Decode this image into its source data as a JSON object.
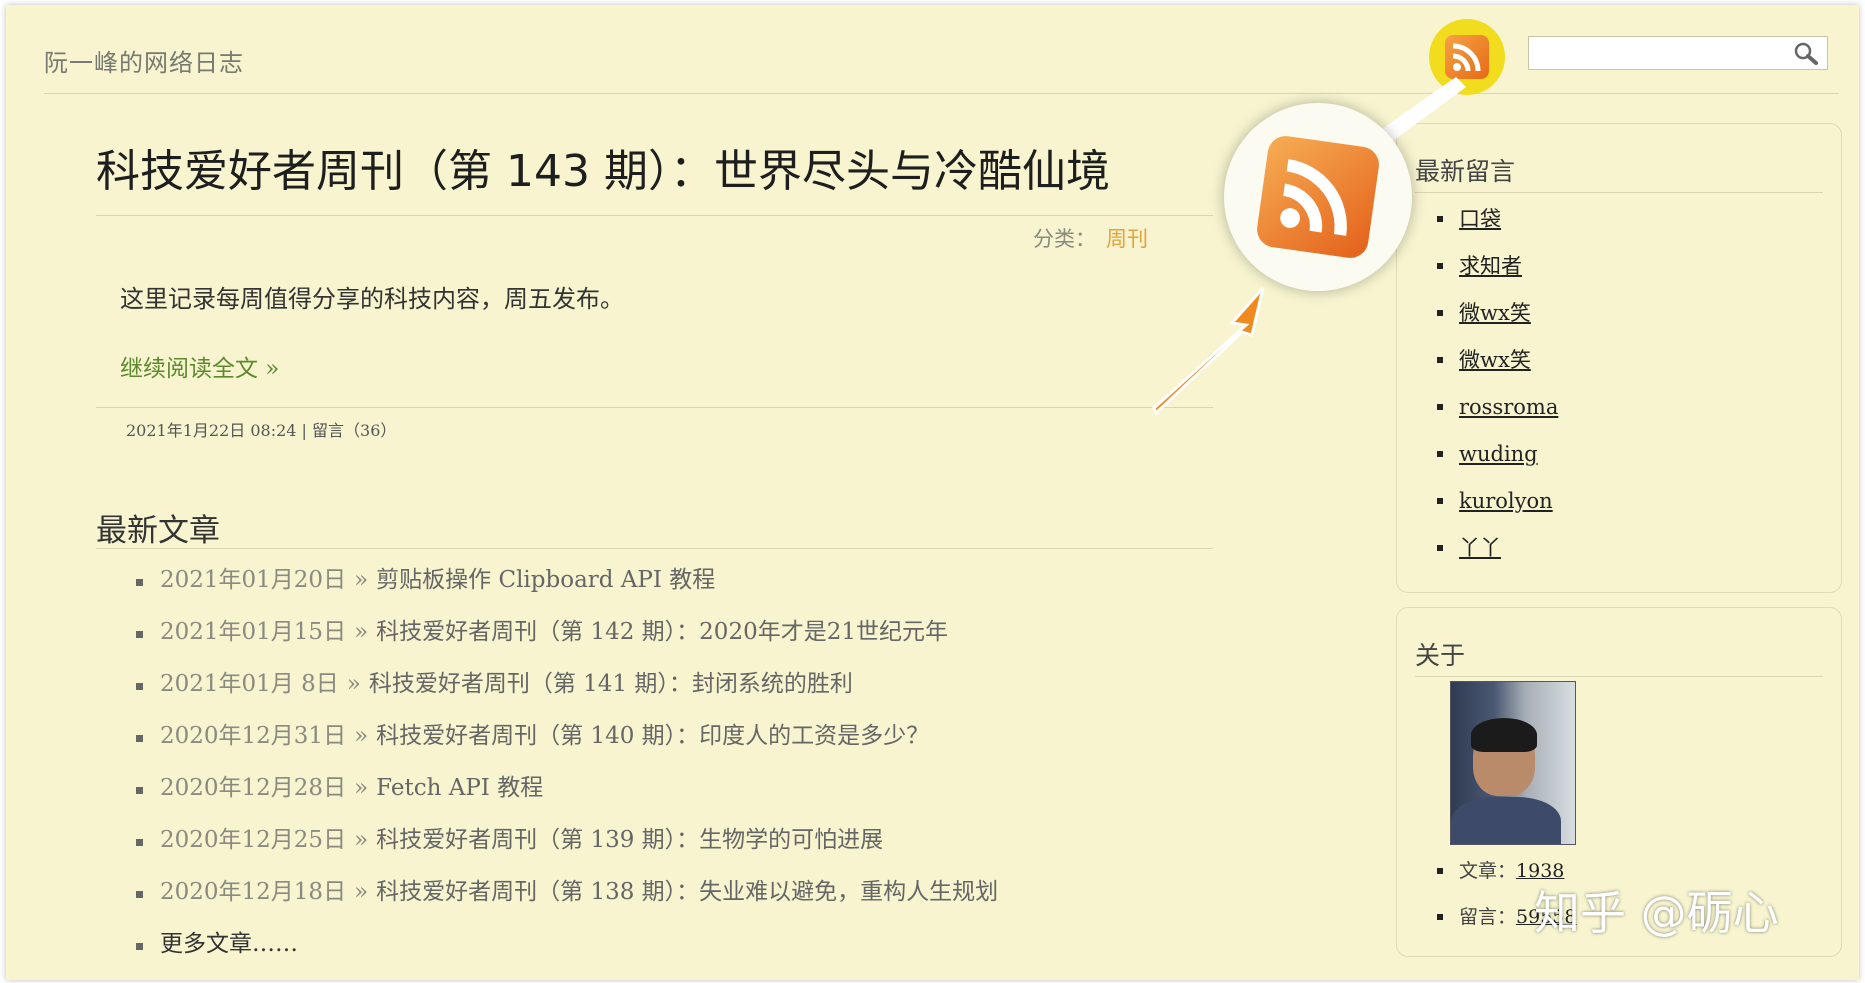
{
  "header": {
    "site_title": "阮一峰的网络日志",
    "search": {
      "placeholder": "",
      "icon": "search-icon"
    },
    "feed_icon": "rss-icon"
  },
  "post": {
    "title": "科技爱好者周刊（第 143 期）：世界尽头与冷酷仙境",
    "category_label": "分类：",
    "category": "周刊",
    "excerpt": "这里记录每周值得分享的科技内容，周五发布。",
    "read_more": "继续阅读全文 »",
    "meta": "2021年1月22日 08:24 | 留言（36）"
  },
  "latest": {
    "heading": "最新文章",
    "separator": "»",
    "items": [
      {
        "date": "2021年01月20日",
        "title": "剪贴板操作 Clipboard API 教程"
      },
      {
        "date": "2021年01月15日",
        "title": "科技爱好者周刊（第 142 期）：2020年才是21世纪元年"
      },
      {
        "date": "2021年01月 8日",
        "title": "科技爱好者周刊（第 141 期）：封闭系统的胜利"
      },
      {
        "date": "2020年12月31日",
        "title": "科技爱好者周刊（第 140 期）：印度人的工资是多少？"
      },
      {
        "date": "2020年12月28日",
        "title": "Fetch API 教程"
      },
      {
        "date": "2020年12月25日",
        "title": "科技爱好者周刊（第 139 期）：生物学的可怕进展"
      },
      {
        "date": "2020年12月18日",
        "title": "科技爱好者周刊（第 138 期）：失业难以避免，重构人生规划"
      }
    ],
    "more": "更多文章……"
  },
  "sidebar": {
    "comments": {
      "heading": "最新留言",
      "items": [
        "口袋",
        "求知者",
        "微wx笑",
        "微wx笑",
        "rossroma",
        "wuding",
        "kurolyon",
        "丫丫"
      ]
    },
    "about": {
      "heading": "关于",
      "articles_label": "文章：",
      "articles_count": "1938",
      "comments_label": "留言：",
      "comments_count": "59558"
    }
  },
  "watermark": {
    "zhihu": "知乎 @砺心"
  },
  "colors": {
    "background": "#f7f4cf",
    "category": "#e2a33a",
    "read_more": "#5e8a2e",
    "arrow": "#f08a1e",
    "rss": "#e66a13"
  }
}
